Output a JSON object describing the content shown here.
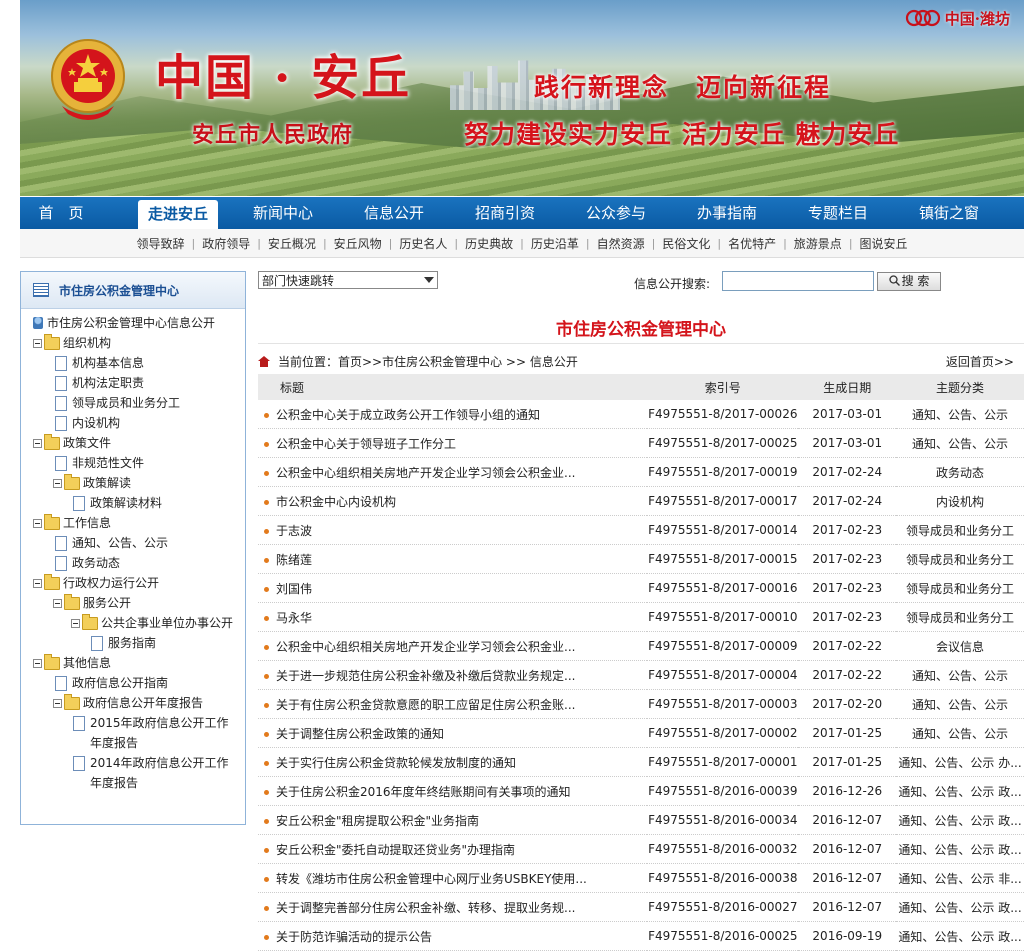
{
  "banner": {
    "title": "中国 · 安丘",
    "subtitle": "安丘市人民政府",
    "slogan1": "践行新理念　迈向新征程",
    "slogan2": "努力建设实力安丘 活力安丘 魅力安丘",
    "top_logo": "中国·潍坊"
  },
  "nav": {
    "items": [
      "首　页",
      "走进安丘",
      "新闻中心",
      "信息公开",
      "招商引资",
      "公众参与",
      "办事指南",
      "专题栏目",
      "镇街之窗"
    ],
    "active": "走进安丘"
  },
  "subnav": {
    "items": [
      "领导致辞",
      "政府领导",
      "安丘概况",
      "安丘风物",
      "历史名人",
      "历史典故",
      "历史沿革",
      "自然资源",
      "民俗文化",
      "名优特产",
      "旅游景点",
      "图说安丘"
    ]
  },
  "sidebar": {
    "header": "市住房公积金管理中心",
    "tree": [
      {
        "label": "市住房公积金管理中心信息公开",
        "level": 0,
        "kind": "root"
      },
      {
        "label": "组织机构",
        "level": 0,
        "kind": "folder"
      },
      {
        "label": "机构基本信息",
        "level": 1,
        "kind": "doc"
      },
      {
        "label": "机构法定职责",
        "level": 1,
        "kind": "doc"
      },
      {
        "label": "领导成员和业务分工",
        "level": 1,
        "kind": "doc"
      },
      {
        "label": "内设机构",
        "level": 1,
        "kind": "doc"
      },
      {
        "label": "政策文件",
        "level": 0,
        "kind": "folder"
      },
      {
        "label": "非规范性文件",
        "level": 1,
        "kind": "doc"
      },
      {
        "label": "政策解读",
        "level": 1,
        "kind": "folder"
      },
      {
        "label": "政策解读材料",
        "level": 2,
        "kind": "doc"
      },
      {
        "label": "工作信息",
        "level": 0,
        "kind": "folder"
      },
      {
        "label": "通知、公告、公示",
        "level": 1,
        "kind": "doc"
      },
      {
        "label": "政务动态",
        "level": 1,
        "kind": "doc"
      },
      {
        "label": "行政权力运行公开",
        "level": 0,
        "kind": "folder"
      },
      {
        "label": "服务公开",
        "level": 1,
        "kind": "folder"
      },
      {
        "label": "公共企事业单位办事公开",
        "level": 2,
        "kind": "folder"
      },
      {
        "label": "服务指南",
        "level": 3,
        "kind": "doc"
      },
      {
        "label": "其他信息",
        "level": 0,
        "kind": "folder"
      },
      {
        "label": "政府信息公开指南",
        "level": 1,
        "kind": "doc"
      },
      {
        "label": "政府信息公开年度报告",
        "level": 1,
        "kind": "folder"
      },
      {
        "label": "2015年政府信息公开工作年度报告",
        "level": 2,
        "kind": "doc"
      },
      {
        "label": "2014年政府信息公开工作年度报告",
        "level": 2,
        "kind": "doc"
      }
    ]
  },
  "toolbar": {
    "dept_select": "部门快速跳转",
    "search_label": "信息公开搜索:",
    "search_value": "",
    "search_button": "搜 索"
  },
  "main": {
    "title": "市住房公积金管理中心",
    "breadcrumb": "当前位置：首页>>市住房公积金管理中心 >> 信息公开",
    "back_home": "返回首页>>",
    "columns": [
      "标题",
      "索引号",
      "生成日期",
      "主题分类"
    ],
    "rows": [
      [
        "公积金中心关于成立政务公开工作领导小组的通知",
        "F4975551-8/2017-00026",
        "2017-03-01",
        "通知、公告、公示"
      ],
      [
        "公积金中心关于领导班子工作分工",
        "F4975551-8/2017-00025",
        "2017-03-01",
        "通知、公告、公示"
      ],
      [
        "公积金中心组织相关房地产开发企业学习领会公积金业...",
        "F4975551-8/2017-00019",
        "2017-02-24",
        "政务动态"
      ],
      [
        "市公积金中心内设机构",
        "F4975551-8/2017-00017",
        "2017-02-24",
        "内设机构"
      ],
      [
        "于志波",
        "F4975551-8/2017-00014",
        "2017-02-23",
        "领导成员和业务分工"
      ],
      [
        "陈绪莲",
        "F4975551-8/2017-00015",
        "2017-02-23",
        "领导成员和业务分工"
      ],
      [
        "刘国伟",
        "F4975551-8/2017-00016",
        "2017-02-23",
        "领导成员和业务分工"
      ],
      [
        "马永华",
        "F4975551-8/2017-00010",
        "2017-02-23",
        "领导成员和业务分工"
      ],
      [
        "公积金中心组织相关房地产开发企业学习领会公积金业...",
        "F4975551-8/2017-00009",
        "2017-02-22",
        "会议信息"
      ],
      [
        "关于进一步规范住房公积金补缴及补缴后贷款业务规定...",
        "F4975551-8/2017-00004",
        "2017-02-22",
        "通知、公告、公示"
      ],
      [
        "关于有住房公积金贷款意愿的职工应留足住房公积金账...",
        "F4975551-8/2017-00003",
        "2017-02-20",
        "通知、公告、公示"
      ],
      [
        "关于调整住房公积金政策的通知",
        "F4975551-8/2017-00002",
        "2017-01-25",
        "通知、公告、公示"
      ],
      [
        "关于实行住房公积金贷款轮候发放制度的通知",
        "F4975551-8/2017-00001",
        "2017-01-25",
        "通知、公告、公示 办..."
      ],
      [
        "关于住房公积金2016年度年终结账期间有关事项的通知",
        "F4975551-8/2016-00039",
        "2016-12-26",
        "通知、公告、公示 政..."
      ],
      [
        "安丘公积金\"租房提取公积金\"业务指南",
        "F4975551-8/2016-00034",
        "2016-12-07",
        "通知、公告、公示 政..."
      ],
      [
        "安丘公积金\"委托自动提取还贷业务\"办理指南",
        "F4975551-8/2016-00032",
        "2016-12-07",
        "通知、公告、公示 政..."
      ],
      [
        "转发《潍坊市住房公积金管理中心网厅业务USBKEY使用...",
        "F4975551-8/2016-00038",
        "2016-12-07",
        "通知、公告、公示 非..."
      ],
      [
        "关于调整完善部分住房公积金补缴、转移、提取业务规...",
        "F4975551-8/2016-00027",
        "2016-12-07",
        "通知、公告、公示 政..."
      ],
      [
        "关于防范诈骗活动的提示公告",
        "F4975551-8/2016-00025",
        "2016-09-19",
        "通知、公告、公示 政..."
      ]
    ]
  }
}
